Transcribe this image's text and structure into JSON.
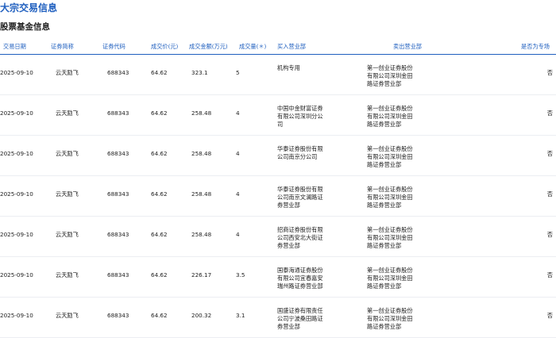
{
  "page_title": "大宗交易信息",
  "section_title": "股票基金信息",
  "columns": [
    "交易日期",
    "证券简称",
    "证券代码",
    "成交价(元)",
    "成交金额(万元)",
    "成交量(＊)",
    "买入营业部",
    "卖出营业部",
    "是否为专场"
  ],
  "rows": [
    {
      "date": "2025-09-10",
      "name": "云天励飞",
      "code": "688343",
      "price": "64.62",
      "amount": "323.1",
      "volume": "5",
      "buyer": "机构专用",
      "seller": "第一创业证券股份有限公司深圳金田路证券营业部",
      "special": "否"
    },
    {
      "date": "2025-09-10",
      "name": "云天励飞",
      "code": "688343",
      "price": "64.62",
      "amount": "258.48",
      "volume": "4",
      "buyer": "中国中金财富证券有限公司深圳分公司",
      "seller": "第一创业证券股份有限公司深圳金田路证券营业部",
      "special": "否"
    },
    {
      "date": "2025-09-10",
      "name": "云天励飞",
      "code": "688343",
      "price": "64.62",
      "amount": "258.48",
      "volume": "4",
      "buyer": "华泰证券股份有限公司南京分公司",
      "seller": "第一创业证券股份有限公司深圳金田路证券营业部",
      "special": "否"
    },
    {
      "date": "2025-09-10",
      "name": "云天励飞",
      "code": "688343",
      "price": "64.62",
      "amount": "258.48",
      "volume": "4",
      "buyer": "华泰证券股份有限公司南京文澜路证券营业部",
      "seller": "第一创业证券股份有限公司深圳金田路证券营业部",
      "special": "否"
    },
    {
      "date": "2025-09-10",
      "name": "云天励飞",
      "code": "688343",
      "price": "64.62",
      "amount": "258.48",
      "volume": "4",
      "buyer": "招商证券股份有限公司西安北大街证券营业部",
      "seller": "第一创业证券股份有限公司深圳金田路证券营业部",
      "special": "否"
    },
    {
      "date": "2025-09-10",
      "name": "云天励飞",
      "code": "688343",
      "price": "64.62",
      "amount": "226.17",
      "volume": "3.5",
      "buyer": "国泰海通证券股份有限公司宜春嘉安瑞州路证券营业部",
      "seller": "第一创业证券股份有限公司深圳金田路证券营业部",
      "special": "否"
    },
    {
      "date": "2025-09-10",
      "name": "云天励飞",
      "code": "688343",
      "price": "64.62",
      "amount": "200.32",
      "volume": "3.1",
      "buyer": "国盛证券有限责任公司宁波桑田路证券营业部",
      "seller": "第一创业证券股份有限公司深圳金田路证券营业部",
      "special": "否"
    }
  ]
}
